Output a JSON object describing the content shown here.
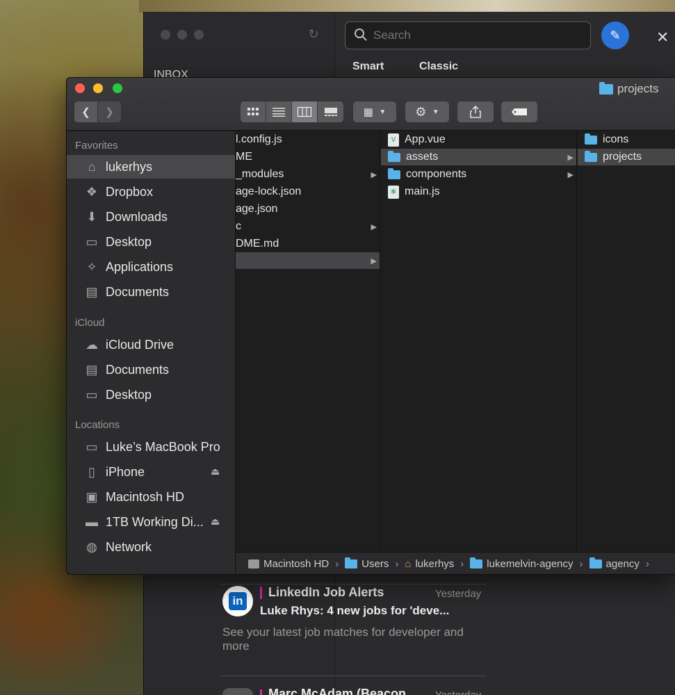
{
  "mail": {
    "inbox_label": "INBOX",
    "search_placeholder": "Search",
    "segments": [
      "Smart",
      "Classic"
    ],
    "messages": [
      {
        "from": "LinkedIn Job Alerts",
        "date": "Yesterday",
        "subject": "Luke Rhys: 4 new jobs for 'deve...",
        "preview": "See your latest job matches for developer and more",
        "accent": "#d02ba8"
      },
      {
        "from": "Marc McAdam (Beacon...",
        "date": "Yesterday",
        "accent": "#d02ba8"
      }
    ]
  },
  "finder": {
    "title": "projects",
    "sidebar": {
      "sections": [
        {
          "heading": "Favorites",
          "items": [
            {
              "label": "lukerhys",
              "icon": "home-icon",
              "selected": true
            },
            {
              "label": "Dropbox",
              "icon": "dropbox-icon"
            },
            {
              "label": "Downloads",
              "icon": "downloads-icon"
            },
            {
              "label": "Desktop",
              "icon": "desktop-icon"
            },
            {
              "label": "Applications",
              "icon": "applications-icon"
            },
            {
              "label": "Documents",
              "icon": "documents-icon"
            }
          ]
        },
        {
          "heading": "iCloud",
          "items": [
            {
              "label": "iCloud Drive",
              "icon": "cloud-icon"
            },
            {
              "label": "Documents",
              "icon": "documents-icon"
            },
            {
              "label": "Desktop",
              "icon": "desktop-icon"
            }
          ]
        },
        {
          "heading": "Locations",
          "items": [
            {
              "label": "Luke’s MacBook Pro",
              "icon": "laptop-icon"
            },
            {
              "label": "iPhone",
              "icon": "iphone-icon",
              "eject": true
            },
            {
              "label": "Macintosh HD",
              "icon": "hard-drive-icon"
            },
            {
              "label": "1TB Working Di...",
              "icon": "external-drive-icon",
              "eject": true
            },
            {
              "label": "Network",
              "icon": "network-icon"
            }
          ]
        }
      ]
    },
    "columns": [
      [
        {
          "label": "l.config.js"
        },
        {
          "label": "ME"
        },
        {
          "label": "_modules",
          "folder": true
        },
        {
          "label": "age-lock.json"
        },
        {
          "label": "age.json"
        },
        {
          "label": "c",
          "folder": true
        },
        {
          "label": "DME.md"
        },
        {
          "label": "",
          "folder": true,
          "selected": true
        }
      ],
      [
        {
          "label": "App.vue",
          "type": "vue"
        },
        {
          "label": "assets",
          "type": "folder",
          "selected": true
        },
        {
          "label": "components",
          "type": "folder"
        },
        {
          "label": "main.js",
          "type": "js"
        }
      ],
      [
        {
          "label": "icons",
          "type": "folder"
        },
        {
          "label": "projects",
          "type": "folder",
          "selected": true
        }
      ]
    ],
    "path": [
      "Macintosh HD",
      "Users",
      "lukerhys",
      "lukemelvin-agency",
      "agency"
    ]
  },
  "colors": {
    "close": "#fe5f57",
    "minimize": "#febc2e",
    "zoom": "#28c840",
    "folder": "#5ab3e8",
    "compose": "#2a74d9"
  }
}
